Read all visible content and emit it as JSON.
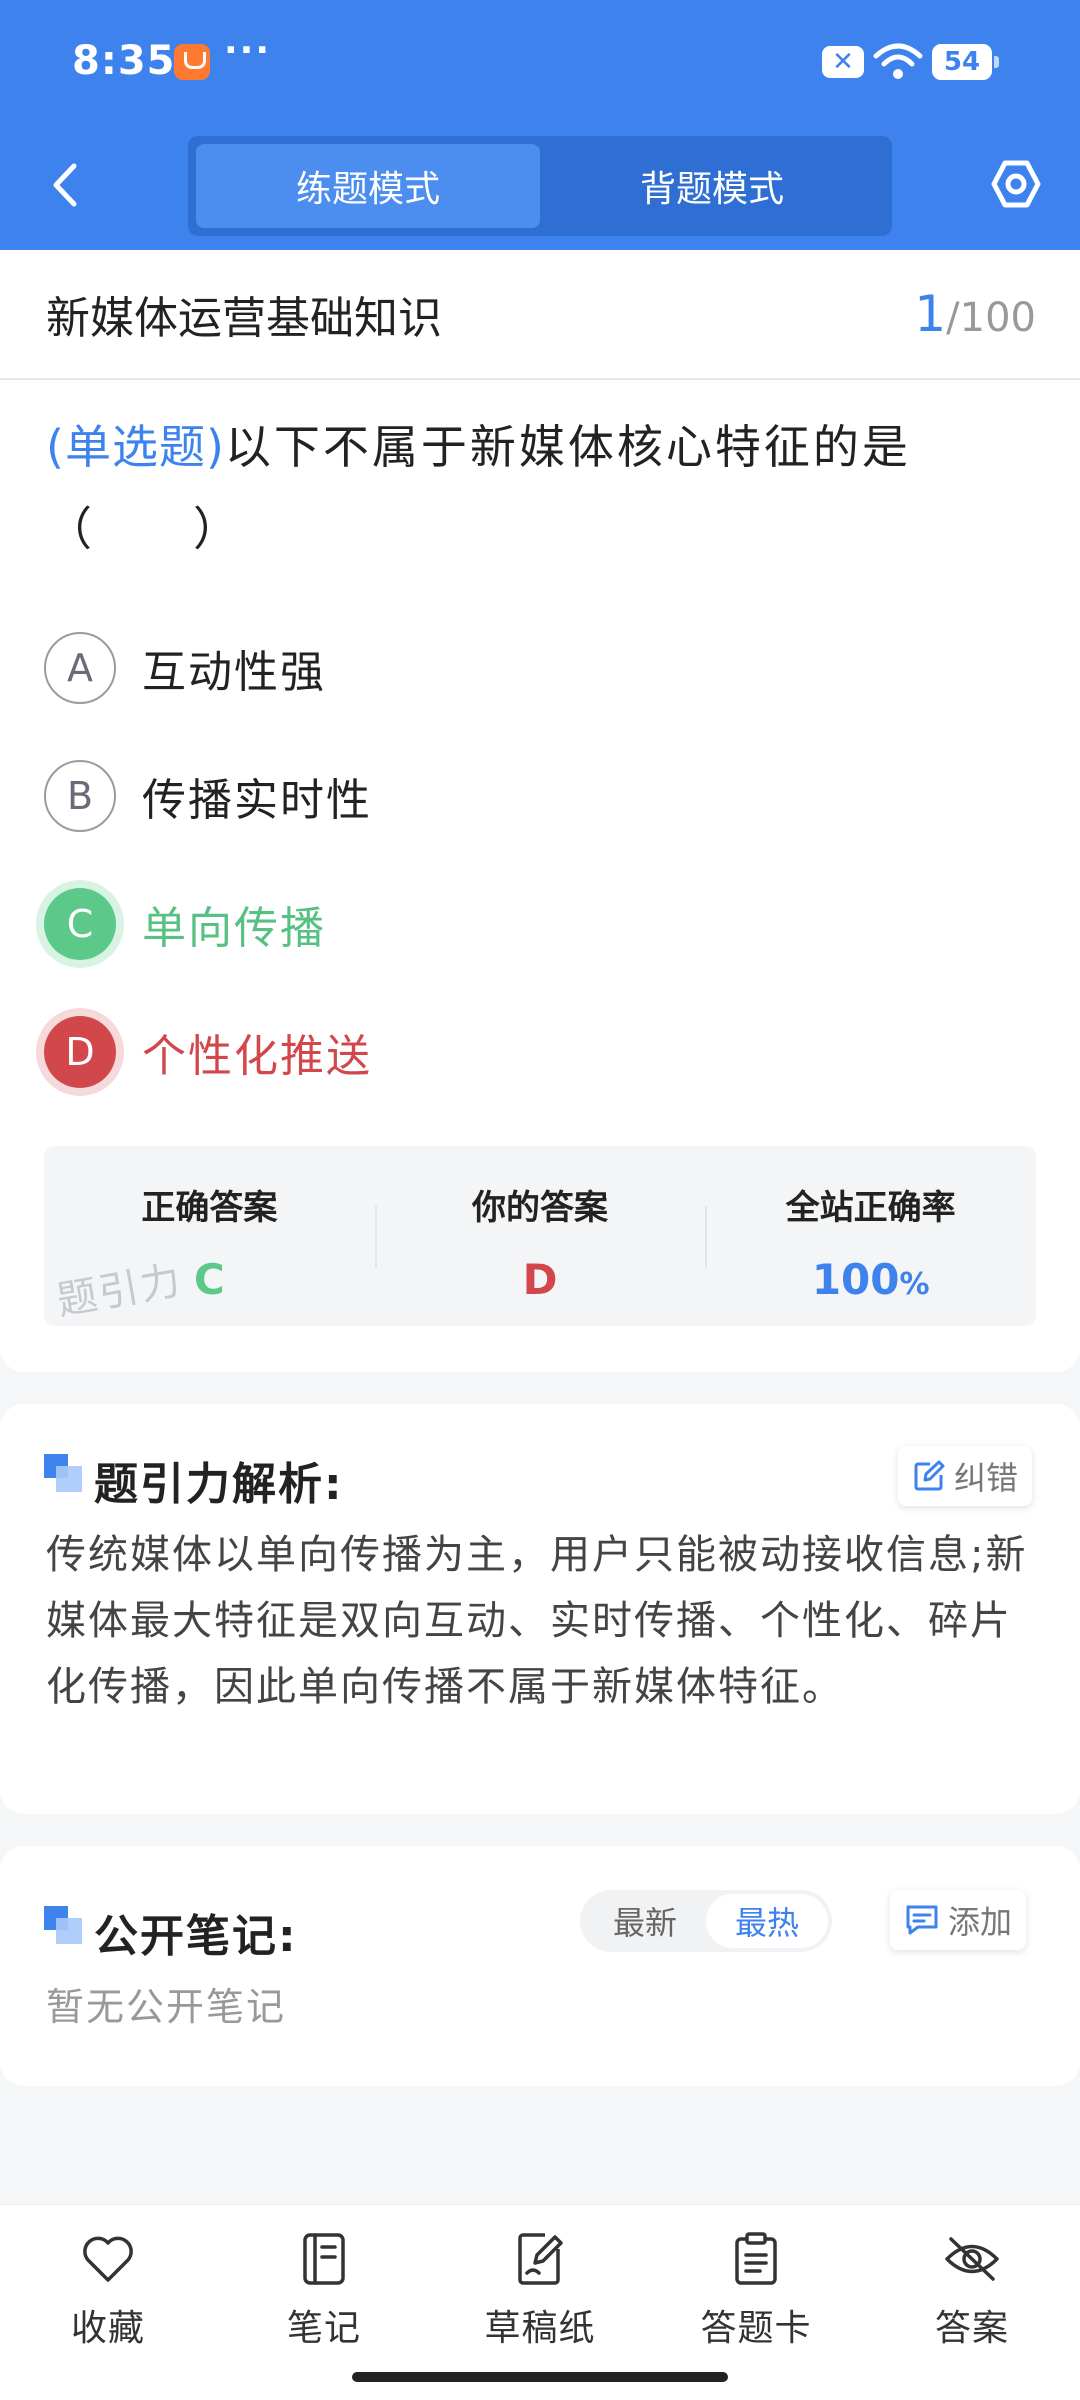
{
  "status_bar": {
    "time": "8:35",
    "more": "···",
    "battery": "54"
  },
  "header": {
    "tabs": [
      {
        "label": "练题模式",
        "active": true
      },
      {
        "label": "背题模式",
        "active": false
      }
    ]
  },
  "question": {
    "category": "新媒体运营基础知识",
    "current": "1",
    "total": "/100",
    "type": "(单选题)",
    "text": "以下不属于新媒体核心特征的是（　　）",
    "options": [
      {
        "letter": "A",
        "text": "互动性强",
        "state": "normal"
      },
      {
        "letter": "B",
        "text": "传播实时性",
        "state": "normal"
      },
      {
        "letter": "C",
        "text": "单向传播",
        "state": "correct"
      },
      {
        "letter": "D",
        "text": "个性化推送",
        "state": "wrong"
      }
    ],
    "summary": {
      "correct_label": "正确答案",
      "correct_value": "C",
      "yours_label": "你的答案",
      "yours_value": "D",
      "rate_label": "全站正确率",
      "rate_value": "100",
      "rate_unit": "%"
    },
    "watermark": "题引力"
  },
  "analysis": {
    "title": "题引力解析:",
    "report_label": "纠错",
    "body": "传统媒体以单向传播为主，用户只能被动接收信息;新媒体最大特征是双向互动、实时传播、个性化、碎片化传播，因此单向传播不属于新媒体特征。"
  },
  "notes": {
    "title": "公开笔记:",
    "sort": [
      {
        "label": "最新",
        "active": false
      },
      {
        "label": "最热",
        "active": true
      }
    ],
    "add_label": "添加",
    "empty": "暂无公开笔记"
  },
  "bottom_bar": [
    {
      "label": "收藏",
      "icon": "heart-icon"
    },
    {
      "label": "笔记",
      "icon": "notebook-icon"
    },
    {
      "label": "草稿纸",
      "icon": "draft-paper-icon"
    },
    {
      "label": "答题卡",
      "icon": "answer-sheet-icon"
    },
    {
      "label": "答案",
      "icon": "eye-off-icon"
    }
  ],
  "colors": {
    "primary": "#3d82ed",
    "correct": "#5cc98a",
    "wrong": "#d2474b"
  }
}
